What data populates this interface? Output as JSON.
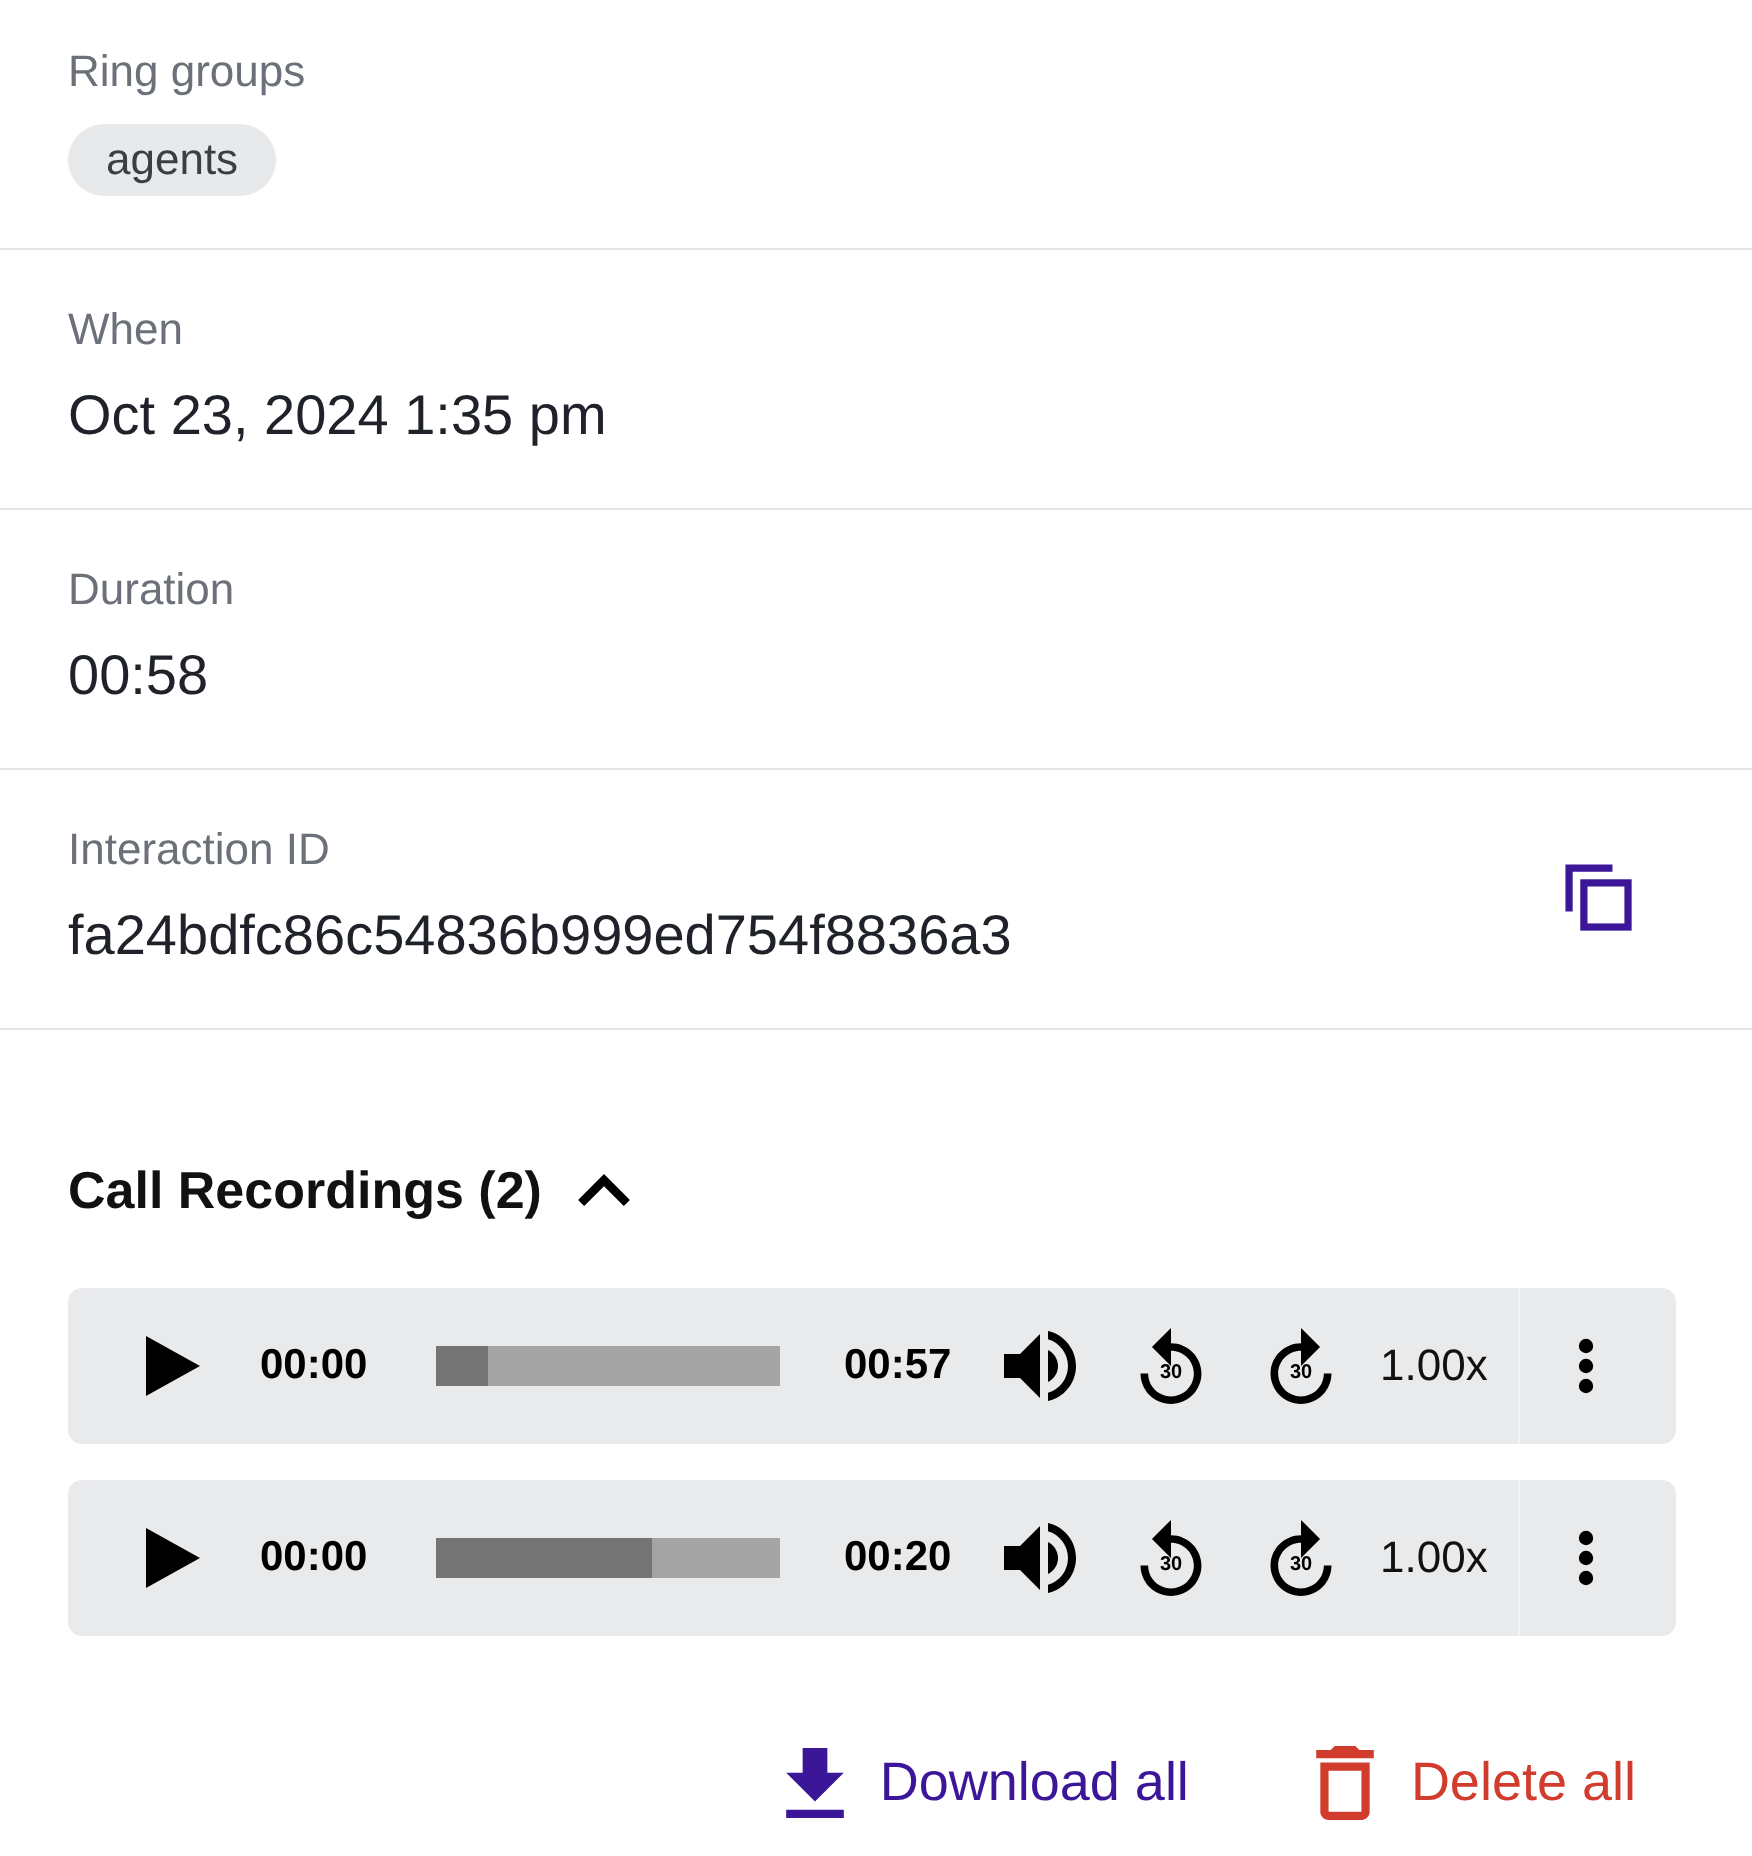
{
  "details": [
    {
      "kind": "chips",
      "label": "Ring groups",
      "chips": [
        "agents"
      ]
    },
    {
      "kind": "text",
      "label": "When",
      "value": "Oct 23, 2024 1:35 pm"
    },
    {
      "kind": "text",
      "label": "Duration",
      "value": "00:58"
    },
    {
      "kind": "copyable",
      "label": "Interaction ID",
      "value": "fa24bdfc86c54836b999ed754f8836a3"
    }
  ],
  "recordings": {
    "title": "Call Recordings (2)",
    "expanded": true,
    "players": [
      {
        "current_time": "00:00",
        "duration": "00:57",
        "level": 0.15,
        "skip_back": "30",
        "skip_forward": "30",
        "speed": "1.00x"
      },
      {
        "current_time": "00:00",
        "duration": "00:20",
        "level": 0.63,
        "skip_back": "30",
        "skip_forward": "30",
        "speed": "1.00x"
      }
    ]
  },
  "actions": [
    {
      "kind": "download",
      "label": "Download all"
    },
    {
      "kind": "delete",
      "label": "Delete all"
    }
  ]
}
